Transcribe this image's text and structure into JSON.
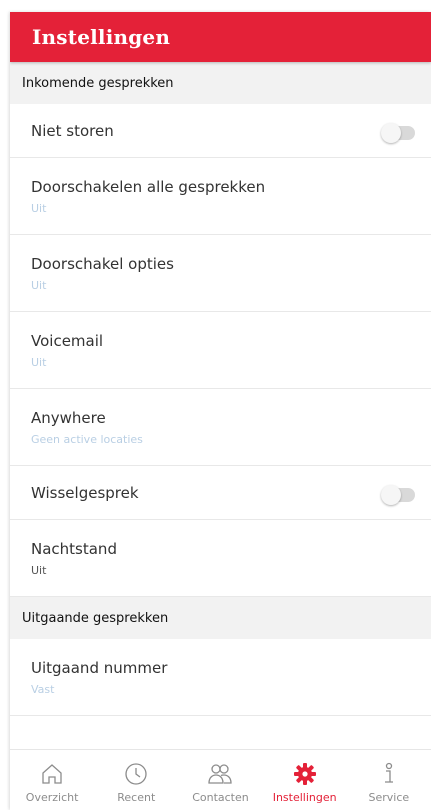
{
  "header": {
    "title": "Instellingen"
  },
  "sections": {
    "incoming": "Inkomende gesprekken",
    "outgoing": "Uitgaande gesprekken"
  },
  "settings": {
    "niet_storen": {
      "label": "Niet storen",
      "enabled": false
    },
    "doorschakelen_alle": {
      "label": "Doorschakelen alle gesprekken",
      "value": "Uit"
    },
    "doorschakel_opties": {
      "label": "Doorschakel opties",
      "value": "Uit"
    },
    "voicemail": {
      "label": "Voicemail",
      "value": "Uit"
    },
    "anywhere": {
      "label": "Anywhere",
      "value": "Geen active locaties"
    },
    "wisselgesprek": {
      "label": "Wisselgesprek",
      "enabled": false
    },
    "nachtstand": {
      "label": "Nachtstand",
      "value": "Uit"
    },
    "uitgaand_nummer": {
      "label": "Uitgaand nummer",
      "value": "Vast"
    }
  },
  "tabs": [
    {
      "label": "Overzicht",
      "icon": "home-icon"
    },
    {
      "label": "Recent",
      "icon": "clock-icon"
    },
    {
      "label": "Contacten",
      "icon": "contacts-icon"
    },
    {
      "label": "Instellingen",
      "icon": "gear-icon",
      "active": true
    },
    {
      "label": "Service",
      "icon": "info-icon"
    }
  ],
  "colors": {
    "brand": "#e42138",
    "sublabel": "#b9cfe4",
    "section_bg": "#f2f2f2"
  }
}
